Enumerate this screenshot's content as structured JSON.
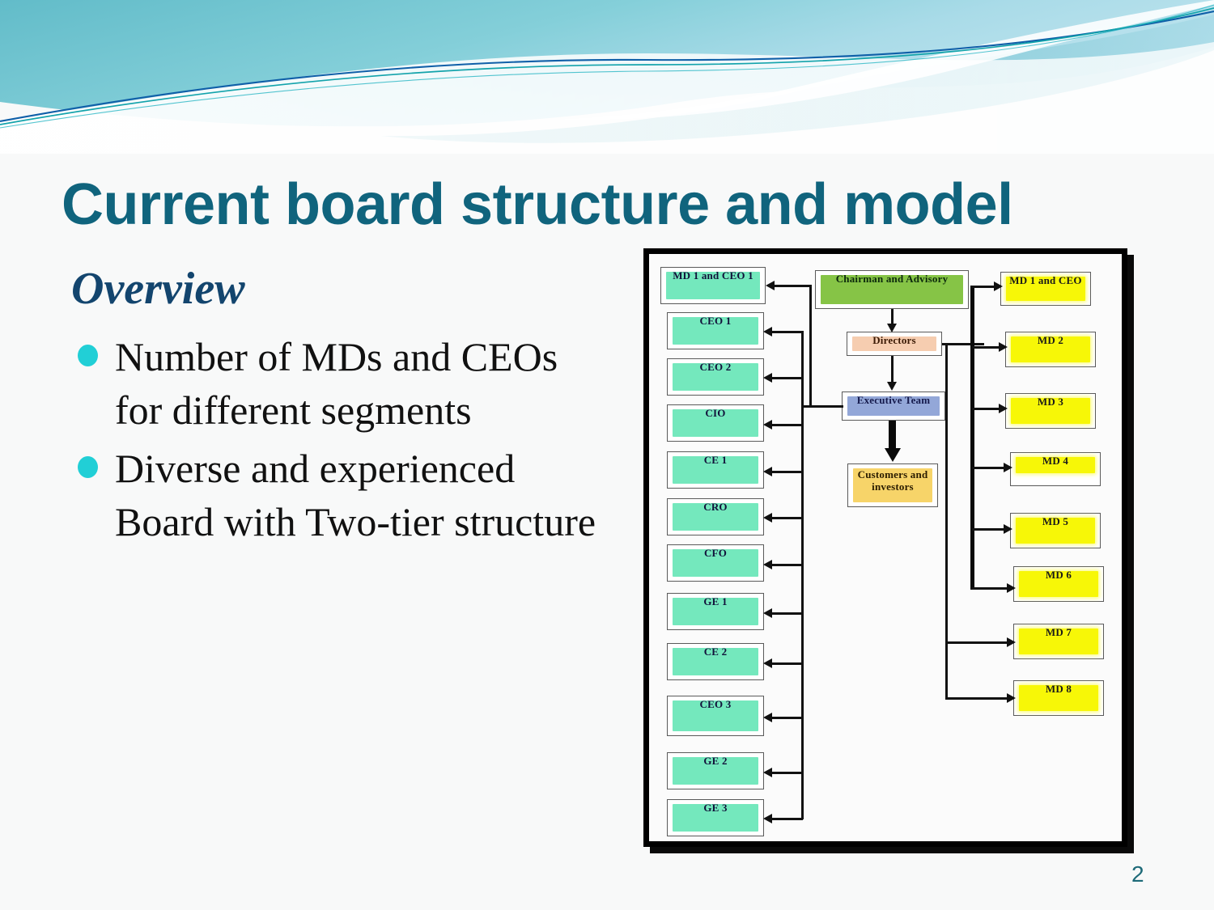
{
  "slide": {
    "title": "Current board structure and model",
    "subhead": "Overview",
    "page_number": "2",
    "bullets": [
      "Number of MDs and CEOs for different segments",
      "Diverse and experienced Board with Two-tier structure"
    ]
  },
  "theme": {
    "title_color": "#10647d",
    "subhead_color": "#13456e",
    "bullet_dot_color": "#21cfd6",
    "banner_teal": "#6fc2cf",
    "background": "#f8f9f9"
  },
  "diagram": {
    "name": "board-structure-org-chart",
    "left_column": [
      {
        "label": "MD 1 and CEO 1",
        "color": "#74e8bd"
      },
      {
        "label": "CEO 1",
        "color": "#74e8bd"
      },
      {
        "label": "CEO 2",
        "color": "#74e8bd"
      },
      {
        "label": "CIO",
        "color": "#74e8bd"
      },
      {
        "label": "CE 1",
        "color": "#74e8bd"
      },
      {
        "label": "CRO",
        "color": "#74e8bd"
      },
      {
        "label": "CFO",
        "color": "#74e8bd"
      },
      {
        "label": "GE 1",
        "color": "#74e8bd"
      },
      {
        "label": "CE 2",
        "color": "#74e8bd"
      },
      {
        "label": "CEO 3",
        "color": "#74e8bd"
      },
      {
        "label": "GE 2",
        "color": "#74e8bd"
      },
      {
        "label": "GE 3",
        "color": "#74e8bd"
      }
    ],
    "center_column": [
      {
        "label": "Chairman and Advisory",
        "color": "#86c446"
      },
      {
        "label": "Directors",
        "color": "#f6cdb0"
      },
      {
        "label": "Executive Team",
        "color": "#93a7d8"
      },
      {
        "label": "Customers and investors",
        "color": "#f7d469"
      }
    ],
    "right_column": [
      {
        "label": "MD 1 and CEO",
        "color": "#f7f707"
      },
      {
        "label": "MD 2",
        "color": "#f7f707"
      },
      {
        "label": "MD 3",
        "color": "#f7f707"
      },
      {
        "label": "MD 4",
        "color": "#f7f707"
      },
      {
        "label": "MD 5",
        "color": "#f7f707"
      },
      {
        "label": "MD 6",
        "color": "#f7f707"
      },
      {
        "label": "MD 7",
        "color": "#f7f707"
      },
      {
        "label": "MD 8",
        "color": "#f7f707"
      }
    ]
  }
}
